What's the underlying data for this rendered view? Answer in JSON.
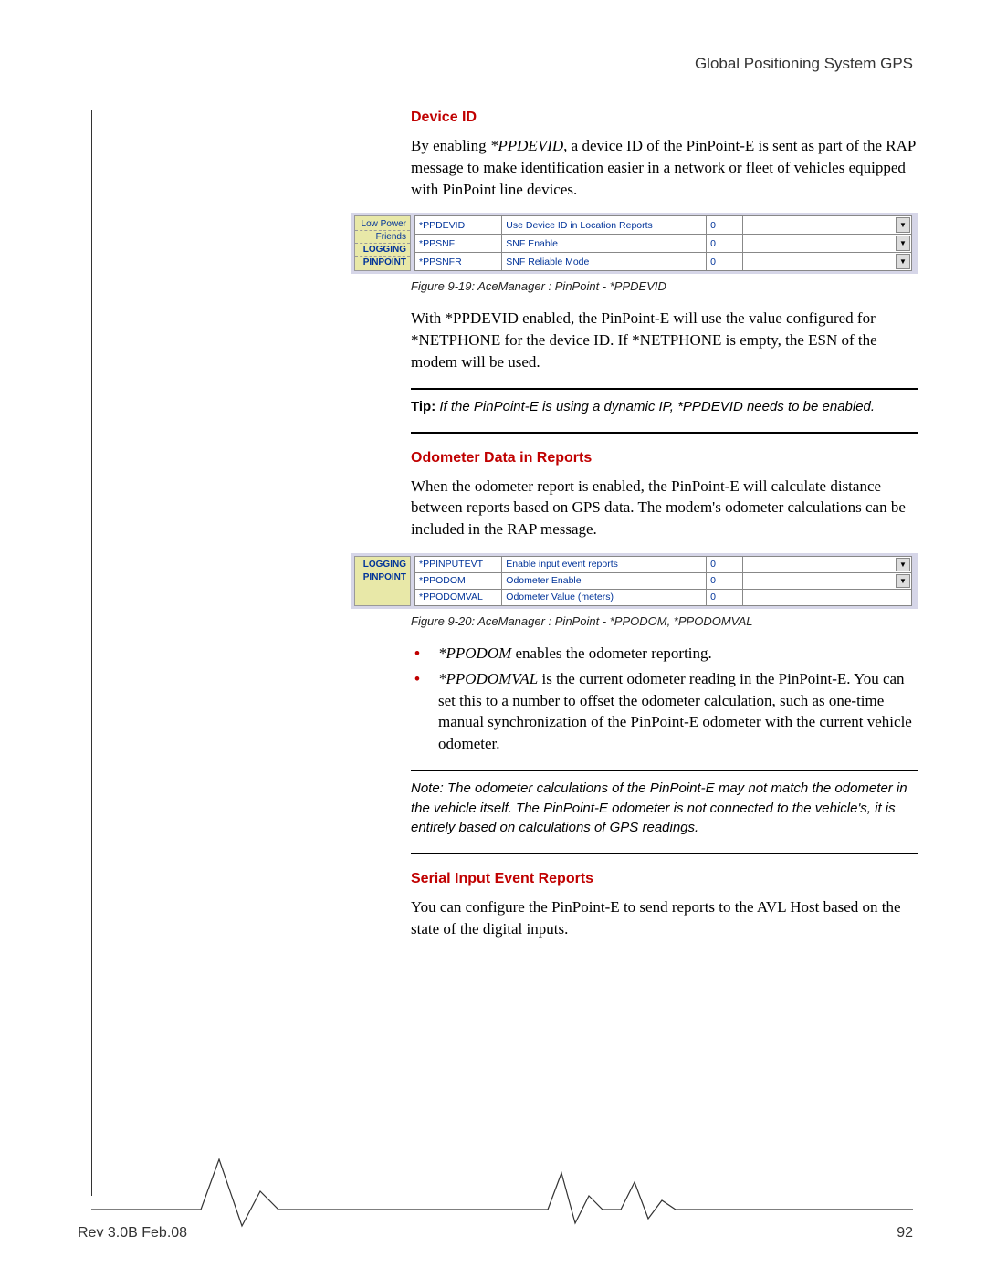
{
  "header": {
    "title": "Global Positioning System GPS"
  },
  "sections": {
    "device_id": {
      "heading": "Device ID",
      "para1_pre": "By enabling ",
      "para1_cmd": "*PPDEVID",
      "para1_post": ", a device ID of the PinPoint-E is sent as part of the RAP message to make identification easier in a network or fleet of vehicles equipped with PinPoint line devices.",
      "para2": "With *PPDEVID enabled, the PinPoint-E will use the value configured for *NETPHONE for the device ID. If *NETPHONE is empty, the ESN of the modem will be used.",
      "tip_label": "Tip:",
      "tip_text": "If the PinPoint-E is using a dynamic IP, *PPDEVID needs to be enabled."
    },
    "odometer": {
      "heading": "Odometer Data in Reports",
      "para1": "When the odometer report is enabled, the PinPoint-E will calculate distance between reports based on GPS data. The modem's odometer calculations can be included in the RAP message.",
      "bullet1_cmd": "*PPODOM",
      "bullet1_text": " enables the odometer reporting.",
      "bullet2_cmd": "*PPODOMVAL",
      "bullet2_text": " is the current odometer reading in the PinPoint-E. You can set this to a number to offset the odometer calculation, such as one-time manual synchronization of the PinPoint-E odometer with the current vehicle odometer.",
      "note": "Note: The odometer calculations of the PinPoint-E may not match the odometer in the vehicle itself. The PinPoint-E odometer is not connected to the vehicle's, it is entirely based on calculations of GPS readings."
    },
    "serial": {
      "heading": "Serial Input Event Reports",
      "para1": "You can configure the PinPoint-E to send reports to the AVL Host based on the state of the digital inputs."
    }
  },
  "figures": {
    "fig19": {
      "caption": "Figure 9-19: AceManager : PinPoint - *PPDEVID",
      "sidebar": [
        "Low Power",
        "Friends",
        "LOGGING",
        "PINPOINT"
      ],
      "sidebar_bold": [
        false,
        false,
        true,
        true
      ],
      "rows": [
        {
          "cmd": "*PPDEVID",
          "desc": "Use Device ID in Location Reports",
          "val": "0",
          "dropdown": true
        },
        {
          "cmd": "*PPSNF",
          "desc": "SNF Enable",
          "val": "0",
          "dropdown": true
        },
        {
          "cmd": "*PPSNFR",
          "desc": "SNF Reliable Mode",
          "val": "0",
          "dropdown": true
        }
      ]
    },
    "fig20": {
      "caption": "Figure 9-20: AceManager : PinPoint - *PPODOM, *PPODOMVAL",
      "sidebar": [
        "LOGGING",
        "PINPOINT"
      ],
      "sidebar_bold": [
        true,
        true
      ],
      "rows": [
        {
          "cmd": "*PPINPUTEVT",
          "desc": "Enable input event reports",
          "val": "0",
          "dropdown": true
        },
        {
          "cmd": "*PPODOM",
          "desc": "Odometer Enable",
          "val": "0",
          "dropdown": true
        },
        {
          "cmd": "*PPODOMVAL",
          "desc": "Odometer Value (meters)",
          "val": "0",
          "dropdown": false
        }
      ]
    }
  },
  "footer": {
    "rev": "Rev 3.0B  Feb.08",
    "page": "92"
  }
}
